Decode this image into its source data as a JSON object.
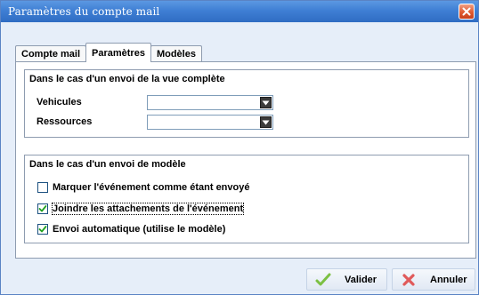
{
  "window": {
    "title": "Paramètres du compte mail",
    "close_icon": "close-icon"
  },
  "tabs": [
    {
      "label": "Compte mail",
      "active": false
    },
    {
      "label": "Paramètres",
      "active": true
    },
    {
      "label": "Modèles",
      "active": false
    }
  ],
  "group_complete": {
    "legend": "Dans le cas d'un envoi de la vue complète",
    "vehicules": {
      "label": "Vehicules",
      "value": ""
    },
    "ressources": {
      "label": "Ressources",
      "value": ""
    }
  },
  "group_model": {
    "legend": "Dans le cas d'un envoi de modèle",
    "checks": [
      {
        "label": "Marquer l'événement comme étant envoyé",
        "checked": false
      },
      {
        "label": "Joindre les attachements de l'événement",
        "checked": true
      },
      {
        "label": "Envoi automatique (utilise le modèle)",
        "checked": true
      }
    ]
  },
  "footer": {
    "validate_label": "Valider",
    "cancel_label": "Annuler"
  },
  "colors": {
    "titlebar": "#3f7fd4",
    "validate_icon": "#7cc043",
    "cancel_icon": "#e05a5a"
  }
}
